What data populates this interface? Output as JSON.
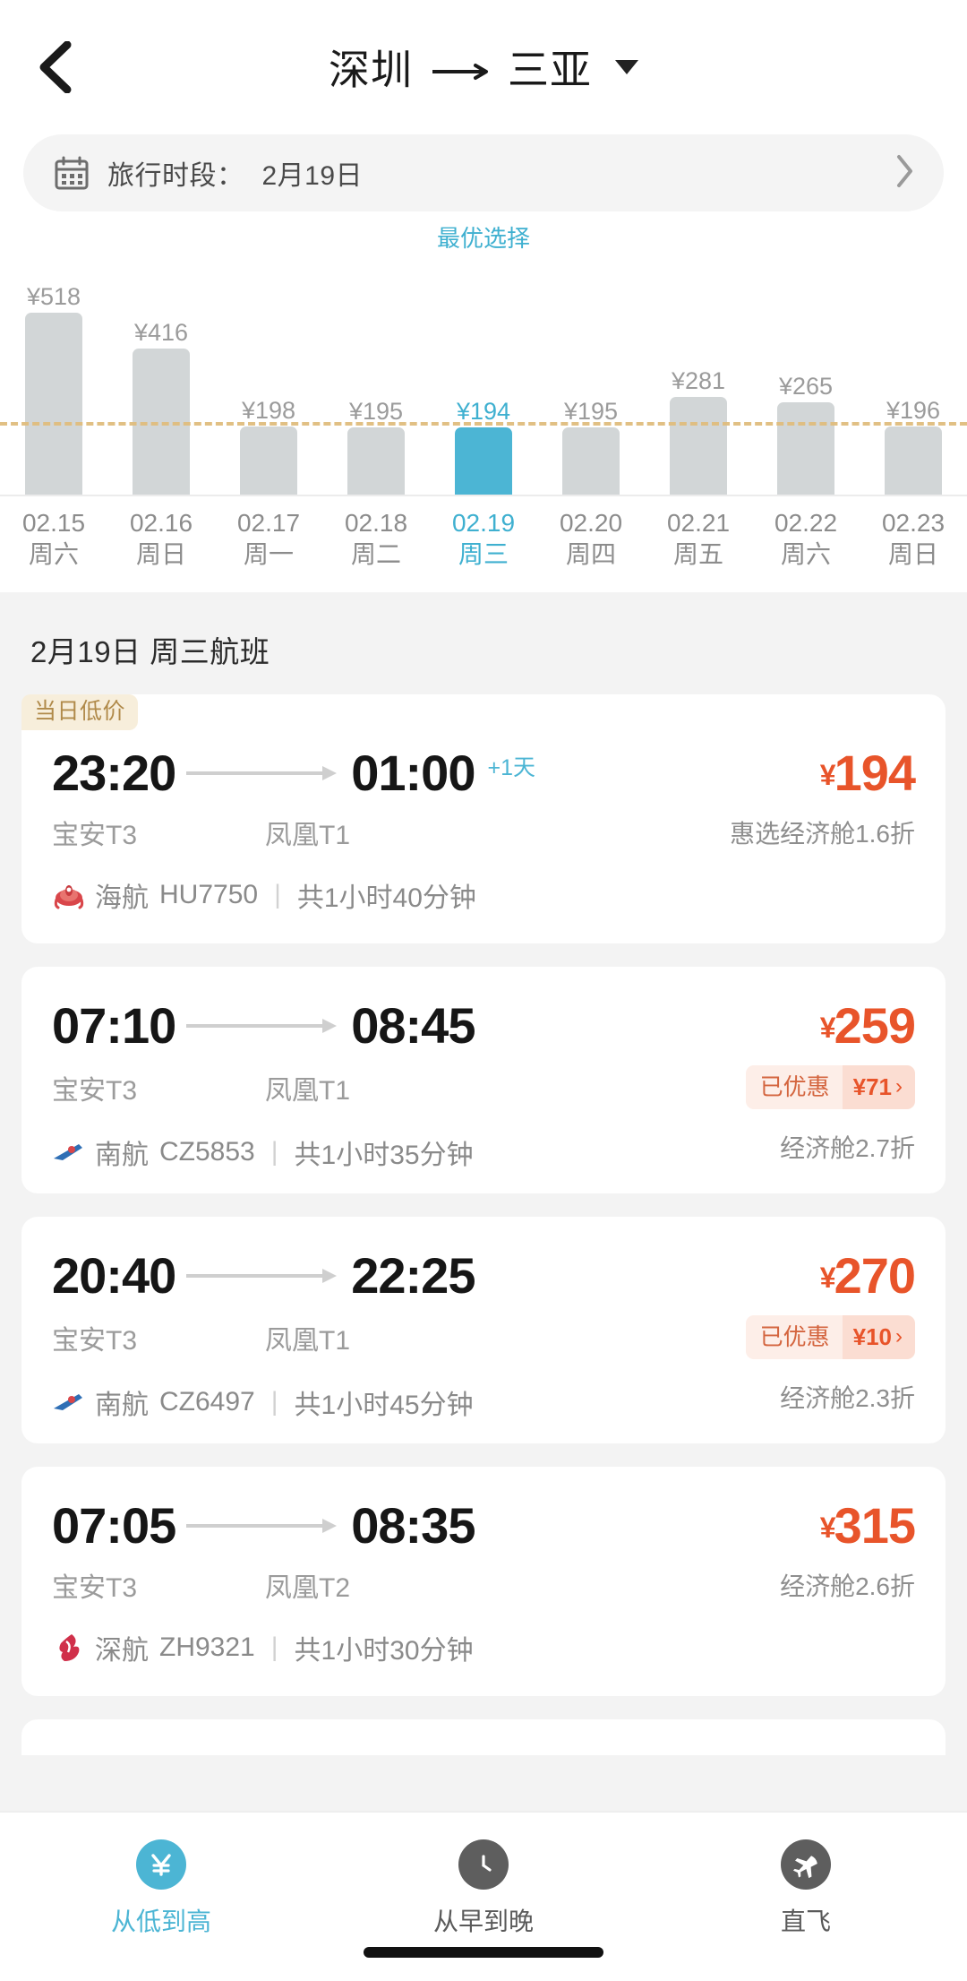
{
  "header": {
    "back_icon": "chevron-left-icon",
    "origin": "深圳",
    "arrow": "⟶",
    "destination": "三亚",
    "dropdown_icon": "caret-down-icon"
  },
  "date_bar": {
    "icon": "calendar-icon",
    "label": "旅行时段：",
    "value": "2月19日",
    "chevron": "›"
  },
  "chart_data": {
    "type": "bar",
    "title": "",
    "xlabel": "",
    "ylabel": "",
    "categories": [
      "02.15",
      "02.16",
      "02.17",
      "02.18",
      "02.19",
      "02.20",
      "02.21",
      "02.22",
      "02.23"
    ],
    "weekdays": [
      "周六",
      "周日",
      "周一",
      "周二",
      "周三",
      "周四",
      "周五",
      "周六",
      "周日"
    ],
    "values": [
      518,
      416,
      198,
      195,
      194,
      195,
      281,
      265,
      196
    ],
    "price_labels": [
      "¥518",
      "¥416",
      "¥198",
      "¥195",
      "¥194",
      "¥195",
      "¥281",
      "¥265",
      "¥196"
    ],
    "selected_index": 4,
    "best_choice_label": "最优选择",
    "average_line_value": 200,
    "ylim": [
      0,
      560
    ],
    "grid": false,
    "legend": "none",
    "bar_color": "#d2d6d7",
    "selected_bar_color": "#4cb5d4",
    "average_line_color": "#e0bd7e",
    "accent_color": "#3fb0d0"
  },
  "list": {
    "title": "2月19日 周三航班",
    "flights": [
      {
        "badge": "当日低价",
        "depart_time": "23:20",
        "arrive_time": "01:00",
        "day_offset": "+1天",
        "depart_terminal": "宝安T3",
        "arrive_terminal": "凤凰T1",
        "price_symbol": "¥",
        "price": "194",
        "cabin": "惠选经济舱1.6折",
        "promo_left": "",
        "promo_right": "",
        "airline_logo": "hainan-airlines-logo",
        "airline": "海航",
        "flight_no": "HU7750",
        "separator": "|",
        "duration": "共1小时40分钟"
      },
      {
        "badge": "",
        "depart_time": "07:10",
        "arrive_time": "08:45",
        "day_offset": "",
        "depart_terminal": "宝安T3",
        "arrive_terminal": "凤凰T1",
        "price_symbol": "¥",
        "price": "259",
        "cabin": "经济舱2.7折",
        "promo_left": "已优惠",
        "promo_right": "¥71",
        "airline_logo": "china-southern-logo",
        "airline": "南航",
        "flight_no": "CZ5853",
        "separator": "|",
        "duration": "共1小时35分钟"
      },
      {
        "badge": "",
        "depart_time": "20:40",
        "arrive_time": "22:25",
        "day_offset": "",
        "depart_terminal": "宝安T3",
        "arrive_terminal": "凤凰T1",
        "price_symbol": "¥",
        "price": "270",
        "cabin": "经济舱2.3折",
        "promo_left": "已优惠",
        "promo_right": "¥10",
        "airline_logo": "china-southern-logo",
        "airline": "南航",
        "flight_no": "CZ6497",
        "separator": "|",
        "duration": "共1小时45分钟"
      },
      {
        "badge": "",
        "depart_time": "07:05",
        "arrive_time": "08:35",
        "day_offset": "",
        "depart_terminal": "宝安T3",
        "arrive_terminal": "凤凰T2",
        "price_symbol": "¥",
        "price": "315",
        "cabin": "经济舱2.6折",
        "promo_left": "",
        "promo_right": "",
        "airline_logo": "shenzhen-airlines-logo",
        "airline": "深航",
        "flight_no": "ZH9321",
        "separator": "|",
        "duration": "共1小时30分钟"
      }
    ]
  },
  "bottom_nav": {
    "items": [
      {
        "icon": "yen-circle-icon",
        "label": "从低到高",
        "active": true
      },
      {
        "icon": "clock-circle-icon",
        "label": "从早到晚",
        "active": false
      },
      {
        "icon": "plane-circle-icon",
        "label": "直飞",
        "active": false
      }
    ]
  }
}
